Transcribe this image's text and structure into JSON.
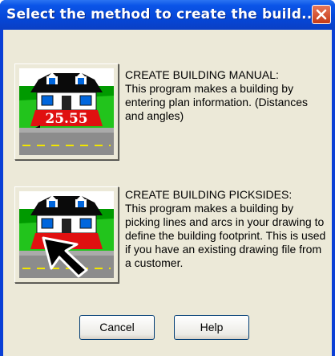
{
  "window": {
    "title": "Select the method to create the build..."
  },
  "options": [
    {
      "heading": "CREATE BUILDING MANUAL:",
      "description": "This program makes a building by entering plan information. (Distances and angles)",
      "image_icon": "house-with-dimension-icon",
      "dimension_label": "25.55"
    },
    {
      "heading": "CREATE BUILDING PICKSIDES:",
      "description": "This program makes a building by picking lines and arcs in your drawing to define the building footprint. This is used if you have an existing drawing file from a customer.",
      "image_icon": "house-with-pointer-icon"
    }
  ],
  "buttons": {
    "cancel": "Cancel",
    "help": "Help"
  },
  "colors": {
    "titlebar": "#0547d8",
    "client": "#ece9d8",
    "close": "#c53a16"
  }
}
